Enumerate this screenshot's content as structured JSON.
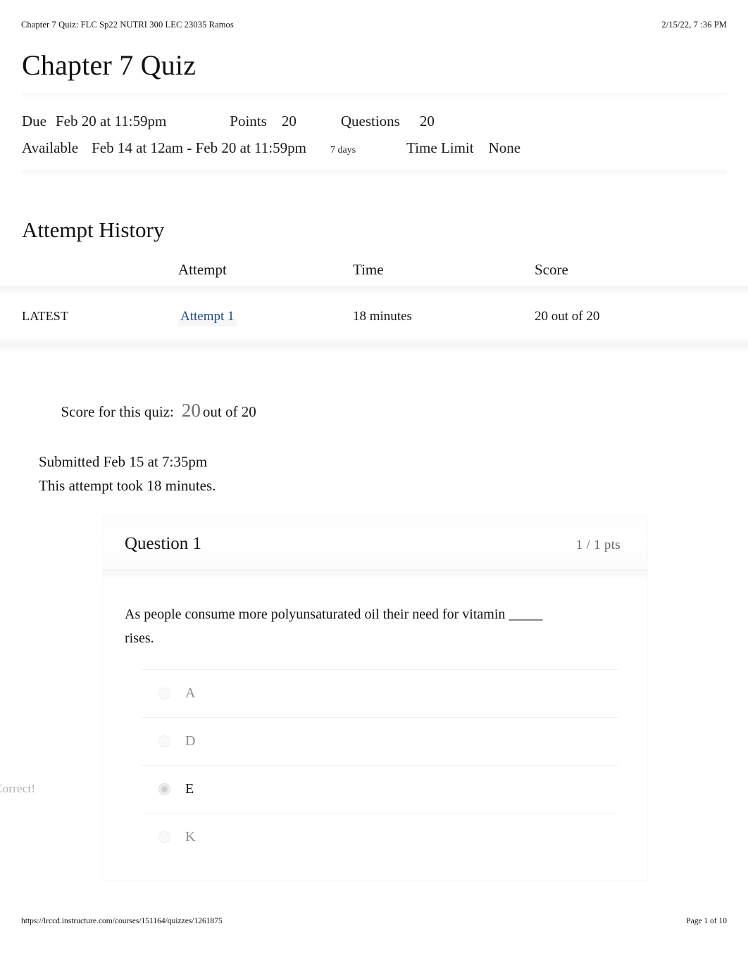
{
  "print_header": {
    "document_title": "Chapter 7 Quiz: FLC Sp22 NUTRI 300 LEC 23035 Ramos",
    "timestamp": "2/15/22, 7 :36 PM"
  },
  "print_footer": {
    "url": "https://lrccd.instructure.com/courses/151164/quizzes/1261875",
    "page_label": "Page 1 of 10"
  },
  "quiz": {
    "title": "Chapter 7 Quiz",
    "meta": {
      "due_label": "Due",
      "due_value": "Feb 20 at 11:59pm",
      "points_label": "Points",
      "points_value": "20",
      "questions_label": "Questions",
      "questions_value": "20",
      "available_label": "Available",
      "available_value": "Feb 14 at 12am - Feb 20 at 11:59pm",
      "available_duration": "7 days",
      "time_limit_label": "Time Limit",
      "time_limit_value": "None"
    }
  },
  "attempt_history": {
    "heading": "Attempt History",
    "columns": [
      "",
      "Attempt",
      "Time",
      "Score"
    ],
    "rows": [
      {
        "flag": "LATEST",
        "attempt": "Attempt 1",
        "time": "18 minutes",
        "score": "20 out of 20"
      }
    ]
  },
  "score_summary": {
    "score_label": "Score for this quiz:",
    "score_value": "20",
    "score_out_of": "out of 20",
    "submitted": "Submitted Feb 15 at 7:35pm",
    "duration": "This attempt took 18 minutes."
  },
  "question": {
    "title": "Question 1",
    "points": "1 / 1 pts",
    "text_line_1": "As people consume more polyunsaturated oil their need for vitamin",
    "blank": "_____",
    "text_line_2": " rises.",
    "correct_flag": "Correct!",
    "answers": [
      {
        "label": "A",
        "selected": false
      },
      {
        "label": "D",
        "selected": false
      },
      {
        "label": "E",
        "selected": true
      },
      {
        "label": "K",
        "selected": false
      }
    ]
  },
  "colors": {
    "link_blue": "#1d4a86",
    "muted_gray": "#8e8e8e",
    "points_gray": "#6a6a6a",
    "flag_gray": "#b0b0b0",
    "text": "#121212"
  }
}
